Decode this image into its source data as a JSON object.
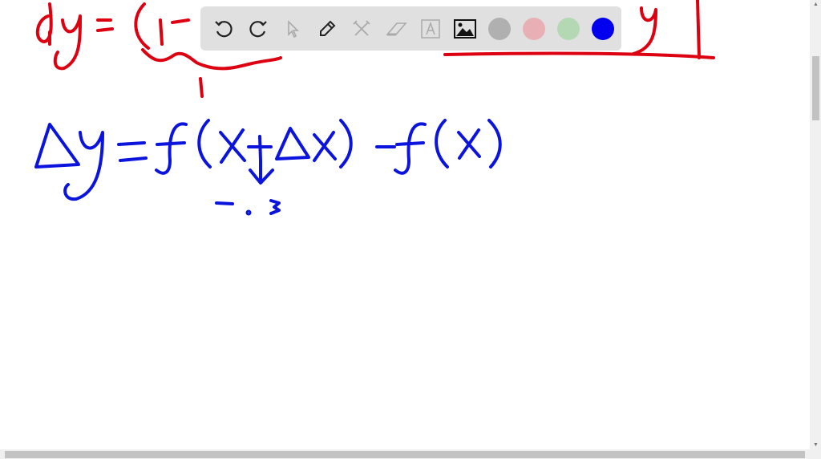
{
  "toolbar": {
    "tools": [
      "undo-icon",
      "redo-icon",
      "select-icon",
      "pen-icon",
      "tools-icon",
      "eraser-icon",
      "text-icon",
      "image-icon"
    ],
    "colors": [
      "#b0b0b0",
      "#e8b0b4",
      "#b4d8b4",
      "#0000ee"
    ],
    "selected_color": "#0000ee"
  },
  "ink": {
    "red": "#dd0011",
    "blue": "#0a14dd"
  }
}
